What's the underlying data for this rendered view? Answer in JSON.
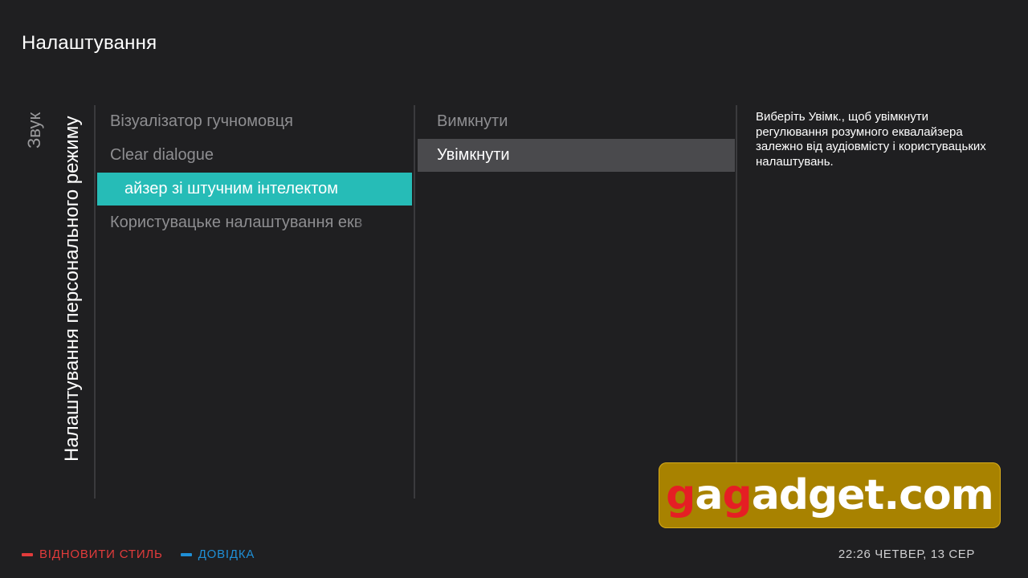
{
  "header": {
    "title": "Налаштування"
  },
  "breadcrumb": {
    "parent": "Звук",
    "current": "Налаштування персонального режиму"
  },
  "menu": {
    "items": [
      {
        "label": "Візуалізатор гучномовця",
        "state": "normal"
      },
      {
        "label": "Clear dialogue",
        "state": "normal"
      },
      {
        "label": "айзер зі штучним інтелектом",
        "state": "active"
      },
      {
        "label": "Користувацьке налаштування екв",
        "state": "normal"
      }
    ]
  },
  "options": {
    "items": [
      {
        "label": "Вимкнути",
        "state": "normal"
      },
      {
        "label": "Увімкнути",
        "state": "selected"
      }
    ]
  },
  "help": {
    "text": "Виберіть Увімк., щоб увімкнути регулювання розумного еквалайзера залежно від аудіовмісту і користувацьких налаштувань."
  },
  "footer": {
    "red_key_label": "ВІДНОВИТИ СТИЛЬ",
    "blue_key_label": "ДОВІДКА",
    "clock": "22:26 ЧЕТВЕР, 13 СЕР"
  },
  "watermark": {
    "part1": "g",
    "part2": "a",
    "part3": "g",
    "part4": "adget.com"
  },
  "colors": {
    "background": "#1f1f21",
    "accent": "#26bcb7",
    "selected_option": "#4a4a4d",
    "red_key": "#e23b3b",
    "blue_key": "#1f8fd6",
    "watermark_bg": "#a88200",
    "watermark_red": "#e51e24"
  }
}
